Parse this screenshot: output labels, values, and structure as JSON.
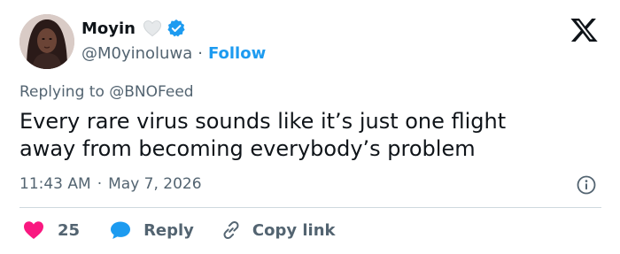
{
  "author": {
    "display_name": "Moyin",
    "handle": "@M0yinoluwa",
    "separator": "·",
    "follow_label": "Follow"
  },
  "tweet": {
    "replying_prefix": "Replying to",
    "replying_to": "@BNOFeed",
    "text_line1": "Every rare virus sounds like it’s just one flight",
    "text_line2": "away from becoming everybody’s problem",
    "time": "11:43 AM",
    "meta_separator": "·",
    "date": "May 7, 2026"
  },
  "actions": {
    "like_count": "25",
    "reply_label": "Reply",
    "copy_label": "Copy link"
  },
  "colors": {
    "accent": "#1d9bf0",
    "like": "#f91880",
    "text": "#0f1419",
    "secondary": "#536471"
  }
}
